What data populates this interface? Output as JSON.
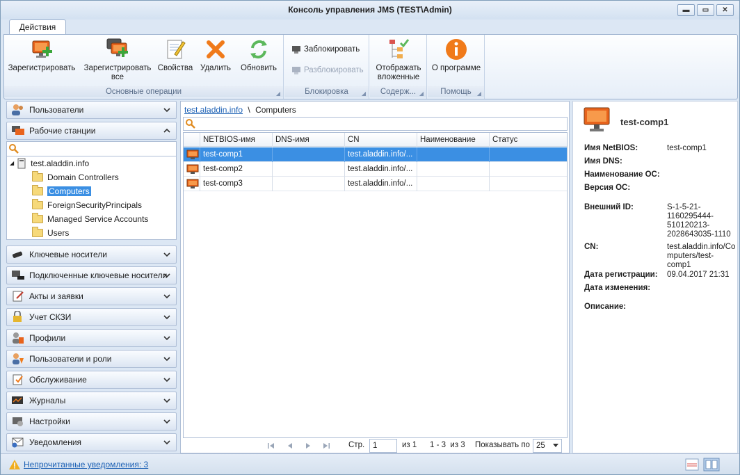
{
  "window": {
    "title": "Консоль управления JMS (TEST\\Admin)",
    "buttons": {
      "minimize": "▬",
      "maximize": "▭",
      "close": "✕"
    }
  },
  "ribbon": {
    "tab_label": "Действия",
    "groups": {
      "main": {
        "caption": "Основные операции",
        "register": "Зарегистрировать",
        "register_all_line1": "Зарегистрировать",
        "register_all_line2": "все",
        "properties": "Свойства",
        "delete": "Удалить",
        "refresh": "Обновить"
      },
      "block": {
        "caption": "Блокировка",
        "block": "Заблокировать",
        "unblock": "Разблокировать"
      },
      "content": {
        "caption": "Содерж...",
        "show_nested_line1": "Отображать",
        "show_nested_line2": "вложенные"
      },
      "help": {
        "caption": "Помощь",
        "about": "О программе"
      }
    }
  },
  "nav": {
    "users": "Пользователи",
    "workstations": "Рабочие станции",
    "tree": {
      "root": "test.aladdin.info",
      "children": [
        "Domain Controllers",
        "Computers",
        "ForeignSecurityPrincipals",
        "Managed Service Accounts",
        "Users"
      ]
    },
    "key_media": "Ключевые носители",
    "connected_key_media": "Подключенные ключевые носители",
    "acts": "Акты и заявки",
    "skzi": "Учет СКЗИ",
    "profiles": "Профили",
    "users_roles": "Пользователи и роли",
    "maintenance": "Обслуживание",
    "logs": "Журналы",
    "settings": "Настройки",
    "notifications": "Уведомления"
  },
  "breadcrumb": {
    "link": "test.aladdin.info",
    "separator": "\\",
    "current": "Computers"
  },
  "grid": {
    "columns": [
      "NETBIOS-имя",
      "DNS-имя",
      "CN",
      "Наименование ОС",
      "Статус"
    ],
    "rows": [
      [
        "test-comp1",
        "",
        "test.aladdin.info/...",
        "",
        ""
      ],
      [
        "test-comp2",
        "",
        "test.aladdin.info/...",
        "",
        ""
      ],
      [
        "test-comp3",
        "",
        "test.aladdin.info/...",
        "",
        ""
      ]
    ]
  },
  "pager": {
    "page_label": "Стр.",
    "page_value": "1",
    "of_pages": "из 1",
    "range": "1 - 3  из 3",
    "show_label": "Показывать по",
    "page_size": "25"
  },
  "details": {
    "title": "test-comp1",
    "netbios_label": "Имя NetBIOS:",
    "netbios_value": "test-comp1",
    "dns_label": "Имя DNS:",
    "os_label": "Наименование ОС:",
    "os_version_label": "Версия ОС:",
    "external_id_label": "Внешний ID:",
    "external_id_lines": [
      "S-1-5-21-",
      "1160295444-",
      "510120213-",
      "2028643035-1110"
    ],
    "cn_label": "CN:",
    "cn_lines": [
      "test.aladdin.info/Co",
      "mputers/test-comp1"
    ],
    "reg_date_label": "Дата регистрации:",
    "reg_date_value": "09.04.2017 21:31",
    "mod_date_label": "Дата изменения:",
    "description_label": "Описание:"
  },
  "status": {
    "unread_notifications": "Непрочитанные уведомления: 3"
  }
}
